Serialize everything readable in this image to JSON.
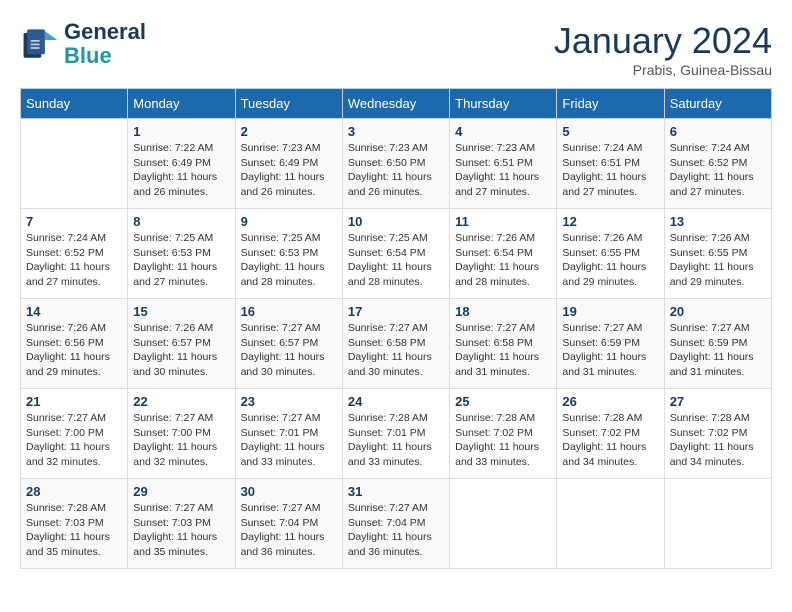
{
  "logo": {
    "line1": "General",
    "line2": "Blue"
  },
  "title": "January 2024",
  "location": "Prabis, Guinea-Bissau",
  "days_of_week": [
    "Sunday",
    "Monday",
    "Tuesday",
    "Wednesday",
    "Thursday",
    "Friday",
    "Saturday"
  ],
  "weeks": [
    [
      {
        "day": "",
        "sunrise": "",
        "sunset": "",
        "daylight": ""
      },
      {
        "day": "1",
        "sunrise": "Sunrise: 7:22 AM",
        "sunset": "Sunset: 6:49 PM",
        "daylight": "Daylight: 11 hours and 26 minutes."
      },
      {
        "day": "2",
        "sunrise": "Sunrise: 7:23 AM",
        "sunset": "Sunset: 6:49 PM",
        "daylight": "Daylight: 11 hours and 26 minutes."
      },
      {
        "day": "3",
        "sunrise": "Sunrise: 7:23 AM",
        "sunset": "Sunset: 6:50 PM",
        "daylight": "Daylight: 11 hours and 26 minutes."
      },
      {
        "day": "4",
        "sunrise": "Sunrise: 7:23 AM",
        "sunset": "Sunset: 6:51 PM",
        "daylight": "Daylight: 11 hours and 27 minutes."
      },
      {
        "day": "5",
        "sunrise": "Sunrise: 7:24 AM",
        "sunset": "Sunset: 6:51 PM",
        "daylight": "Daylight: 11 hours and 27 minutes."
      },
      {
        "day": "6",
        "sunrise": "Sunrise: 7:24 AM",
        "sunset": "Sunset: 6:52 PM",
        "daylight": "Daylight: 11 hours and 27 minutes."
      }
    ],
    [
      {
        "day": "7",
        "sunrise": "Sunrise: 7:24 AM",
        "sunset": "Sunset: 6:52 PM",
        "daylight": "Daylight: 11 hours and 27 minutes."
      },
      {
        "day": "8",
        "sunrise": "Sunrise: 7:25 AM",
        "sunset": "Sunset: 6:53 PM",
        "daylight": "Daylight: 11 hours and 27 minutes."
      },
      {
        "day": "9",
        "sunrise": "Sunrise: 7:25 AM",
        "sunset": "Sunset: 6:53 PM",
        "daylight": "Daylight: 11 hours and 28 minutes."
      },
      {
        "day": "10",
        "sunrise": "Sunrise: 7:25 AM",
        "sunset": "Sunset: 6:54 PM",
        "daylight": "Daylight: 11 hours and 28 minutes."
      },
      {
        "day": "11",
        "sunrise": "Sunrise: 7:26 AM",
        "sunset": "Sunset: 6:54 PM",
        "daylight": "Daylight: 11 hours and 28 minutes."
      },
      {
        "day": "12",
        "sunrise": "Sunrise: 7:26 AM",
        "sunset": "Sunset: 6:55 PM",
        "daylight": "Daylight: 11 hours and 29 minutes."
      },
      {
        "day": "13",
        "sunrise": "Sunrise: 7:26 AM",
        "sunset": "Sunset: 6:55 PM",
        "daylight": "Daylight: 11 hours and 29 minutes."
      }
    ],
    [
      {
        "day": "14",
        "sunrise": "Sunrise: 7:26 AM",
        "sunset": "Sunset: 6:56 PM",
        "daylight": "Daylight: 11 hours and 29 minutes."
      },
      {
        "day": "15",
        "sunrise": "Sunrise: 7:26 AM",
        "sunset": "Sunset: 6:57 PM",
        "daylight": "Daylight: 11 hours and 30 minutes."
      },
      {
        "day": "16",
        "sunrise": "Sunrise: 7:27 AM",
        "sunset": "Sunset: 6:57 PM",
        "daylight": "Daylight: 11 hours and 30 minutes."
      },
      {
        "day": "17",
        "sunrise": "Sunrise: 7:27 AM",
        "sunset": "Sunset: 6:58 PM",
        "daylight": "Daylight: 11 hours and 30 minutes."
      },
      {
        "day": "18",
        "sunrise": "Sunrise: 7:27 AM",
        "sunset": "Sunset: 6:58 PM",
        "daylight": "Daylight: 11 hours and 31 minutes."
      },
      {
        "day": "19",
        "sunrise": "Sunrise: 7:27 AM",
        "sunset": "Sunset: 6:59 PM",
        "daylight": "Daylight: 11 hours and 31 minutes."
      },
      {
        "day": "20",
        "sunrise": "Sunrise: 7:27 AM",
        "sunset": "Sunset: 6:59 PM",
        "daylight": "Daylight: 11 hours and 31 minutes."
      }
    ],
    [
      {
        "day": "21",
        "sunrise": "Sunrise: 7:27 AM",
        "sunset": "Sunset: 7:00 PM",
        "daylight": "Daylight: 11 hours and 32 minutes."
      },
      {
        "day": "22",
        "sunrise": "Sunrise: 7:27 AM",
        "sunset": "Sunset: 7:00 PM",
        "daylight": "Daylight: 11 hours and 32 minutes."
      },
      {
        "day": "23",
        "sunrise": "Sunrise: 7:27 AM",
        "sunset": "Sunset: 7:01 PM",
        "daylight": "Daylight: 11 hours and 33 minutes."
      },
      {
        "day": "24",
        "sunrise": "Sunrise: 7:28 AM",
        "sunset": "Sunset: 7:01 PM",
        "daylight": "Daylight: 11 hours and 33 minutes."
      },
      {
        "day": "25",
        "sunrise": "Sunrise: 7:28 AM",
        "sunset": "Sunset: 7:02 PM",
        "daylight": "Daylight: 11 hours and 33 minutes."
      },
      {
        "day": "26",
        "sunrise": "Sunrise: 7:28 AM",
        "sunset": "Sunset: 7:02 PM",
        "daylight": "Daylight: 11 hours and 34 minutes."
      },
      {
        "day": "27",
        "sunrise": "Sunrise: 7:28 AM",
        "sunset": "Sunset: 7:02 PM",
        "daylight": "Daylight: 11 hours and 34 minutes."
      }
    ],
    [
      {
        "day": "28",
        "sunrise": "Sunrise: 7:28 AM",
        "sunset": "Sunset: 7:03 PM",
        "daylight": "Daylight: 11 hours and 35 minutes."
      },
      {
        "day": "29",
        "sunrise": "Sunrise: 7:27 AM",
        "sunset": "Sunset: 7:03 PM",
        "daylight": "Daylight: 11 hours and 35 minutes."
      },
      {
        "day": "30",
        "sunrise": "Sunrise: 7:27 AM",
        "sunset": "Sunset: 7:04 PM",
        "daylight": "Daylight: 11 hours and 36 minutes."
      },
      {
        "day": "31",
        "sunrise": "Sunrise: 7:27 AM",
        "sunset": "Sunset: 7:04 PM",
        "daylight": "Daylight: 11 hours and 36 minutes."
      },
      {
        "day": "",
        "sunrise": "",
        "sunset": "",
        "daylight": ""
      },
      {
        "day": "",
        "sunrise": "",
        "sunset": "",
        "daylight": ""
      },
      {
        "day": "",
        "sunrise": "",
        "sunset": "",
        "daylight": ""
      }
    ]
  ]
}
